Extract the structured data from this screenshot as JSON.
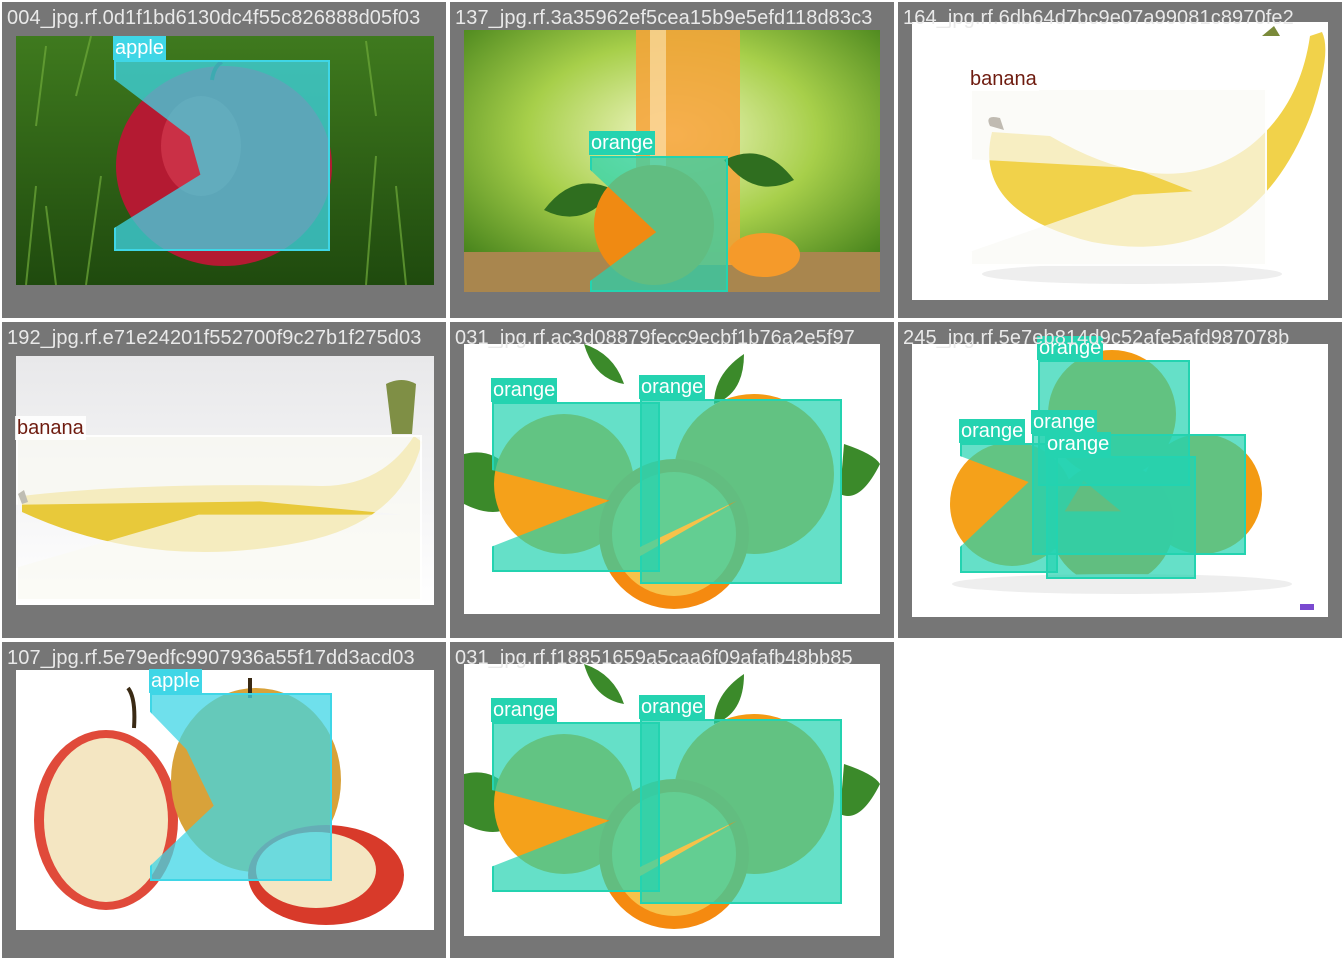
{
  "colors": {
    "tile_bg": "#767676",
    "apple_box": "#3fd6e6",
    "orange_box": "#24d3b0",
    "banana_label": "#6e1b0f",
    "title_text": "#e9e9e9"
  },
  "tiles": [
    {
      "name": "004_jpg.rf.0d1f1bd6130dc4f55c826888d05f03",
      "boxes": [
        {
          "label": "apple",
          "class": "apple"
        }
      ]
    },
    {
      "name": "137_jpg.rf.3a35962ef5cea15b9e5efd118d83c3",
      "boxes": [
        {
          "label": "orange",
          "class": "orange"
        }
      ]
    },
    {
      "name": "164_jpg.rf.6db64d7bc9e07a99081c8970fe2",
      "boxes": [
        {
          "label": "banana",
          "class": "banana"
        }
      ]
    },
    {
      "name": "192_jpg.rf.e71e24201f552700f9c27b1f275d03",
      "boxes": [
        {
          "label": "banana",
          "class": "banana"
        }
      ]
    },
    {
      "name": "031_jpg.rf.ac3d08879fecc9ecbf1b76a2e5f97",
      "boxes": [
        {
          "label": "orange",
          "class": "orange"
        },
        {
          "label": "orange",
          "class": "orange"
        }
      ]
    },
    {
      "name": "245_jpg.rf.5e7eb814d9c52afe5afd987078b",
      "boxes": [
        {
          "label": "orange",
          "class": "orange"
        },
        {
          "label": "orange",
          "class": "orange"
        },
        {
          "label": "orange",
          "class": "orange"
        },
        {
          "label": "orange",
          "class": "orange"
        }
      ]
    },
    {
      "name": "107_jpg.rf.5e79edfc9907936a55f17dd3acd03",
      "boxes": [
        {
          "label": "apple",
          "class": "apple"
        }
      ]
    },
    {
      "name": "031_jpg.rf.f18851659a5caa6f09afafb48bb85",
      "boxes": [
        {
          "label": "orange",
          "class": "orange"
        },
        {
          "label": "orange",
          "class": "orange"
        }
      ]
    }
  ]
}
